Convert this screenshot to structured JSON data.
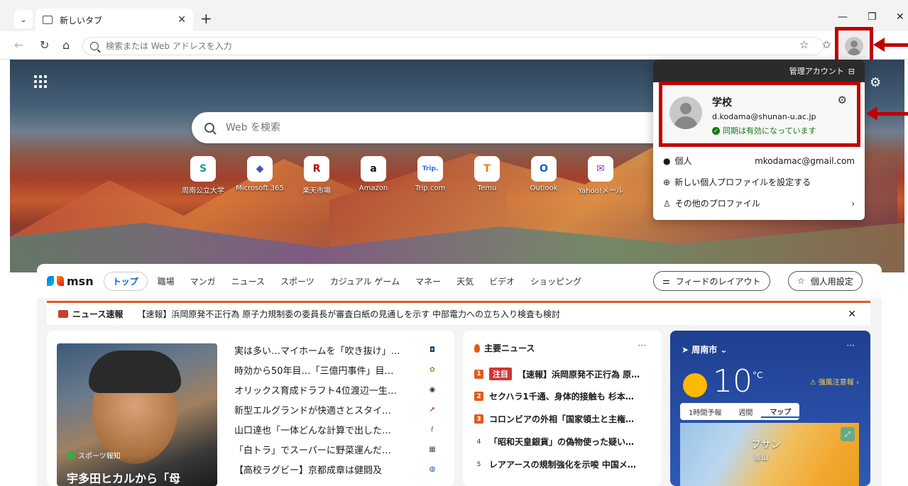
{
  "browser": {
    "tab_title": "新しいタブ",
    "address_placeholder": "検索または Web アドレスを入力"
  },
  "search": {
    "placeholder": "Web を検索"
  },
  "quick_links": [
    {
      "label": "周南公立大学",
      "icon": "S",
      "color": "#1a9c8a"
    },
    {
      "label": "Microsoft 365",
      "icon": "◆",
      "color": "#4b53bc"
    },
    {
      "label": "楽天市場",
      "icon": "R",
      "color": "#bf0000"
    },
    {
      "label": "Amazon",
      "icon": "a",
      "color": "#111111"
    },
    {
      "label": "Trip.com",
      "icon": "Trip.",
      "color": "#2e6fe0"
    },
    {
      "label": "Temu",
      "icon": "T",
      "color": "#f57c00"
    },
    {
      "label": "Outlook",
      "icon": "O",
      "color": "#0a64c8"
    },
    {
      "label": "Yahoo!メール",
      "icon": "✉",
      "color": "#8a2be2"
    }
  ],
  "profile_panel": {
    "managed": "管理アカウント",
    "work_name": "学校",
    "work_email": "d.kodama@shunan-u.ac.jp",
    "sync_status": "同期は有効になっています",
    "personal_label": "個人",
    "personal_email": "mkodamac@gmail.com",
    "new_profile": "新しい個人プロファイルを設定する",
    "other_profiles": "その他のプロファイル"
  },
  "msn": {
    "logo": "msn",
    "nav": [
      "トップ",
      "職場",
      "マンガ",
      "ニュース",
      "スポーツ",
      "カジュアル ゲーム",
      "マネー",
      "天気",
      "ビデオ",
      "ショッピング"
    ],
    "feed_layout": "フィードのレイアウト",
    "personalize": "個人用設定",
    "breaking_label": "ニュース速報",
    "breaking_text": "【速報】浜岡原発不正行為 原子力規制委の委員長が審査白紙の見通しを示す 中部電力への立ち入り検査も検討",
    "photo_source": "スポーツ報知",
    "photo_caption": "宇多田ヒカルから「母",
    "headlines": [
      "実は多い…マイホームを「吹き抜け」…",
      "時効から50年目…「三億円事件」目…",
      "オリックス育成ドラフト4位渡辺一生…",
      "新型エルグランドが快適さとスタイ…",
      "山口達也「一体どんな計算で出した…",
      "「白トラ」でスーパーに野菜運んだ…",
      "【高校ラグビー】京都成章は健闘及"
    ],
    "top_news_title": "主要ニュース",
    "top_news_tag": "注目",
    "top_news": [
      "【速報】浜岡原発不正行為 原…",
      "セクハラ1千通、身体的接触も 杉本…",
      "コロンビアの外相「国家領土と主権…",
      "「昭和天皇銀貨」の偽物使った疑い…",
      "レアアースの規制強化を示唆 中国メ…"
    ],
    "weather": {
      "location": "周南市",
      "temp": "10",
      "unit": "°C",
      "warning": "強風注意報",
      "tabs": [
        "1時間予報",
        "週間",
        "マップ"
      ],
      "map_label": "プサン",
      "map_sub": "釜山"
    }
  }
}
